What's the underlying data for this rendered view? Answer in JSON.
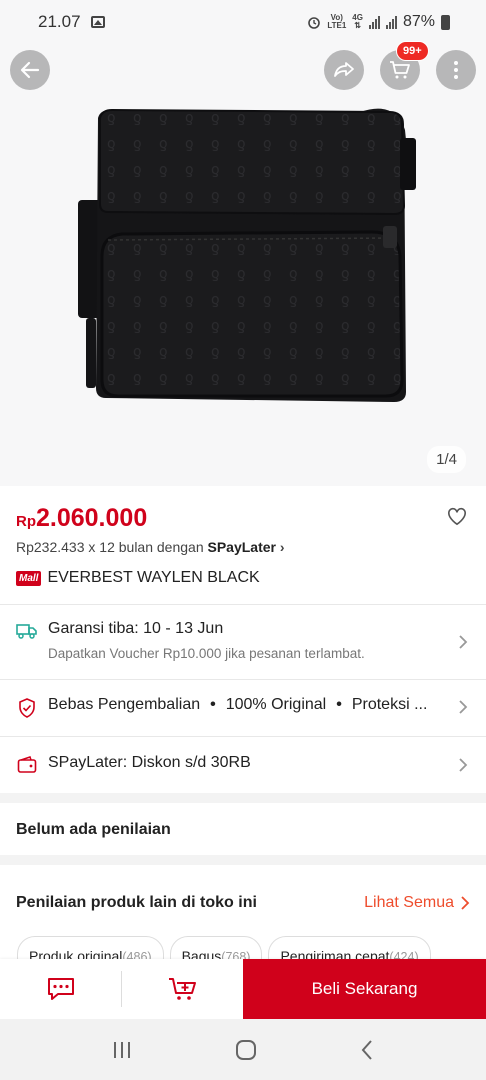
{
  "status": {
    "time": "21.07",
    "net_top": "Vo)",
    "net_bottom": "LTE1",
    "gen": "4G",
    "battery": "87%"
  },
  "hero": {
    "image_counter": "1/4",
    "cart_badge": "99+"
  },
  "product": {
    "currency": "Rp",
    "price": "2.060.000",
    "installment_prefix": "Rp232.433 x 12 bulan dengan ",
    "installment_brand": "SPayLater",
    "mall_label": "Mall",
    "name": "EVERBEST WAYLEN BLACK"
  },
  "shipping": {
    "main": "Garansi tiba: 10 - 13 Jun",
    "sub": "Dapatkan Voucher Rp10.000 jika pesanan terlambat."
  },
  "guarantees": [
    "Bebas Pengembalian",
    "100% Original",
    "Proteksi ..."
  ],
  "paylater": {
    "label": "SPayLater: Diskon s/d 30RB"
  },
  "rating": {
    "title": "Belum ada penilaian"
  },
  "shop_reviews": {
    "title": "Penilaian produk lain di toko ini",
    "see_all": "Lihat Semua",
    "chips": [
      {
        "label": "Produk original",
        "count": "(486)"
      },
      {
        "label": "Bagus",
        "count": "(768)"
      },
      {
        "label": "Pengiriman cepat",
        "count": "(424)"
      }
    ]
  },
  "actions": {
    "buy_now": "Beli Sekarang"
  },
  "colors": {
    "accent": "#d0011b",
    "orange": "#ee4d2d",
    "green": "#26aa99"
  }
}
